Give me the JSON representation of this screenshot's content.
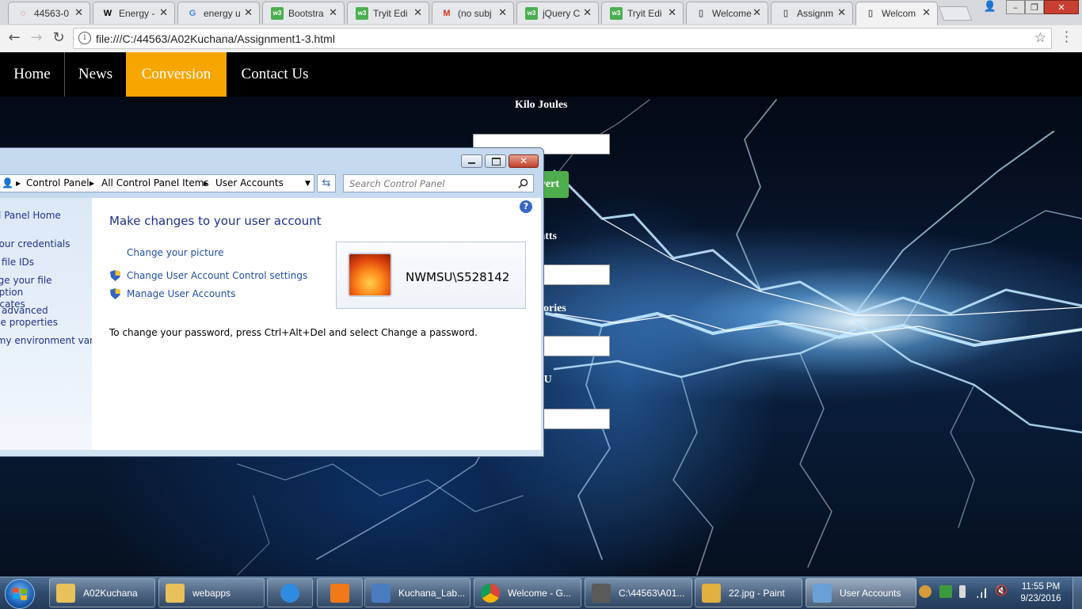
{
  "browser": {
    "tabs": [
      {
        "title": "44563-0",
        "icon": "opera-circle-icon",
        "color": "#d33a2c",
        "glyph": "◌"
      },
      {
        "title": "Energy -",
        "icon": "wikipedia-icon",
        "color": "#000000",
        "glyph": "W"
      },
      {
        "title": "energy u",
        "icon": "google-icon",
        "color": "#4285f4",
        "glyph": "G"
      },
      {
        "title": "Bootstra",
        "icon": "w3schools-icon",
        "color": "#4caf50",
        "glyph": "w3"
      },
      {
        "title": "Tryit Edi",
        "icon": "w3schools-icon",
        "color": "#4caf50",
        "glyph": "w3"
      },
      {
        "title": "(no subj",
        "icon": "gmail-icon",
        "color": "#d93025",
        "glyph": "M"
      },
      {
        "title": "jQuery C",
        "icon": "w3schools-icon",
        "color": "#4caf50",
        "glyph": "w3"
      },
      {
        "title": "Tryit Edi",
        "icon": "w3schools-icon",
        "color": "#4caf50",
        "glyph": "w3"
      },
      {
        "title": "Welcome",
        "icon": "page-icon",
        "color": "#666666",
        "glyph": "▯"
      },
      {
        "title": "Assignm",
        "icon": "page-icon",
        "color": "#666666",
        "glyph": "▯"
      },
      {
        "title": "Welcom",
        "icon": "page-icon",
        "color": "#666666",
        "glyph": "▯"
      }
    ],
    "tab_close": "✕",
    "url": "file:///C:/44563/A02Kuchana/Assignment1-3.html",
    "info_glyph": "i",
    "back_glyph": "←",
    "forward_glyph": "→",
    "reload_glyph": "↻",
    "star_glyph": "☆"
  },
  "site": {
    "nav": [
      "Home",
      "News",
      "Conversion",
      "Contact Us"
    ],
    "active_nav": "Conversion",
    "accent": "#f7a600",
    "form": {
      "label_kilojoules": "Kilo Joules",
      "convert_button": "Convert",
      "label_watts": "Watts",
      "label_calories": "Calories",
      "label_fourth": "BTU"
    }
  },
  "control_panel": {
    "breadcrumb": [
      "Control Panel",
      "All Control Panel Items",
      "User Accounts"
    ],
    "search_placeholder": "Search Control Panel",
    "sidebar": [
      "Control Panel Home",
      "Manage your credentials",
      "Create a file IDs",
      "Manage your file encryption certificates",
      "Configure advanced user profile properties",
      "Change my environment variables"
    ],
    "title": "Make changes to your user account",
    "links": [
      "Change your picture",
      "Change User Account Control settings",
      "Manage User Accounts"
    ],
    "password_hint": "To change your password, press Ctrl+Alt+Del and select Change a password.",
    "username": "NWMSU\\S528142",
    "help_glyph": "?"
  },
  "taskbar": {
    "items": [
      {
        "label": "A02Kuchana",
        "icon": "folder-icon",
        "color": "#e8c15a"
      },
      {
        "label": "webapps",
        "icon": "folder-icon",
        "color": "#e8c15a"
      },
      {
        "label": "",
        "icon": "internet-explorer-icon",
        "color": "#2f8be0"
      },
      {
        "label": "",
        "icon": "media-player-icon",
        "color": "#f07a1a"
      },
      {
        "label": "Kuchana_Lab...",
        "icon": "virtualbox-icon",
        "color": "#4c7cc0"
      },
      {
        "label": "Welcome - G...",
        "icon": "chrome-icon",
        "color": "#db4437"
      },
      {
        "label": "C:\\44563\\A01...",
        "icon": "sublime-text-icon",
        "color": "#5a5a5a"
      },
      {
        "label": "22.jpg - Paint",
        "icon": "paint-icon",
        "color": "#e0b040"
      },
      {
        "label": "User Accounts",
        "icon": "user-accounts-icon",
        "color": "#6aa0d8"
      }
    ],
    "time": "11:55 PM",
    "date": "9/23/2016"
  }
}
